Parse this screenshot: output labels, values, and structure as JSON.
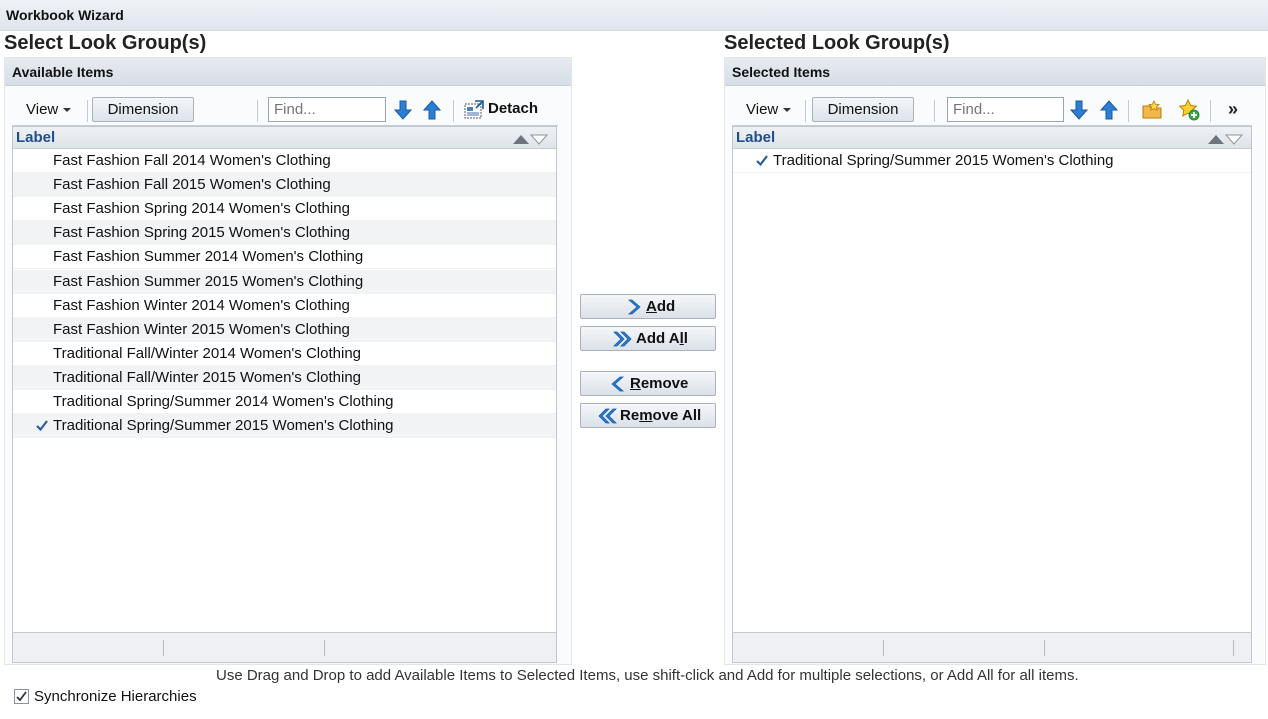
{
  "window": {
    "title": "Workbook Wizard"
  },
  "left": {
    "section_title": "Select Look Group(s)",
    "panel_title": "Available Items",
    "toolbar": {
      "view_label": "View",
      "dimension_label": "Dimension",
      "find_placeholder": "Find...",
      "detach_label": "Detach",
      "icons": [
        "arrow-down-icon",
        "arrow-up-icon",
        "detach-icon"
      ]
    },
    "column_label": "Label",
    "rows": [
      {
        "label": "Fast Fashion Fall 2014 Women's Clothing",
        "checked": false
      },
      {
        "label": "Fast Fashion Fall 2015 Women's Clothing",
        "checked": false
      },
      {
        "label": "Fast Fashion Spring 2014 Women's Clothing",
        "checked": false
      },
      {
        "label": "Fast Fashion Spring 2015 Women's Clothing",
        "checked": false
      },
      {
        "label": "Fast Fashion Summer 2014 Women's Clothing",
        "checked": false
      },
      {
        "label": "Fast Fashion Summer 2015 Women's Clothing",
        "checked": false
      },
      {
        "label": "Fast Fashion Winter 2014 Women's Clothing",
        "checked": false
      },
      {
        "label": "Fast Fashion Winter 2015 Women's Clothing",
        "checked": false
      },
      {
        "label": "Traditional Fall/Winter 2014 Women's Clothing",
        "checked": false
      },
      {
        "label": "Traditional Fall/Winter 2015 Women's Clothing",
        "checked": false
      },
      {
        "label": "Traditional Spring/Summer 2014 Women's Clothing",
        "checked": false
      },
      {
        "label": "Traditional Spring/Summer 2015 Women's Clothing",
        "checked": true
      }
    ]
  },
  "right": {
    "section_title": "Selected Look Group(s)",
    "panel_title": "Selected Items",
    "toolbar": {
      "view_label": "View",
      "dimension_label": "Dimension",
      "find_placeholder": "Find...",
      "more_label": "»",
      "icons": [
        "arrow-down-icon",
        "arrow-up-icon",
        "folder-star-icon",
        "add-favorite-icon"
      ]
    },
    "column_label": "Label",
    "rows": [
      {
        "label": "Traditional Spring/Summer 2015 Women's Clothing",
        "checked": true
      }
    ]
  },
  "shuttle": {
    "add": {
      "pre": "",
      "mn": "A",
      "post": "dd"
    },
    "add_all": {
      "pre": "Add A",
      "mn": "l",
      "post": "l"
    },
    "remove": {
      "pre": "",
      "mn": "R",
      "post": "emove"
    },
    "remove_all": {
      "pre": "Re",
      "mn": "m",
      "post": "ove All"
    }
  },
  "hint": "Use Drag and Drop to add Available Items to Selected Items, use shift-click and Add for multiple selections, or Add All for all items.",
  "sync": {
    "label": "Synchronize Hierarchies",
    "checked": true
  },
  "colors": {
    "accent": "#1f4e8c",
    "arrow_blue": "#2a7fd4",
    "check": "#2b5f9e"
  }
}
